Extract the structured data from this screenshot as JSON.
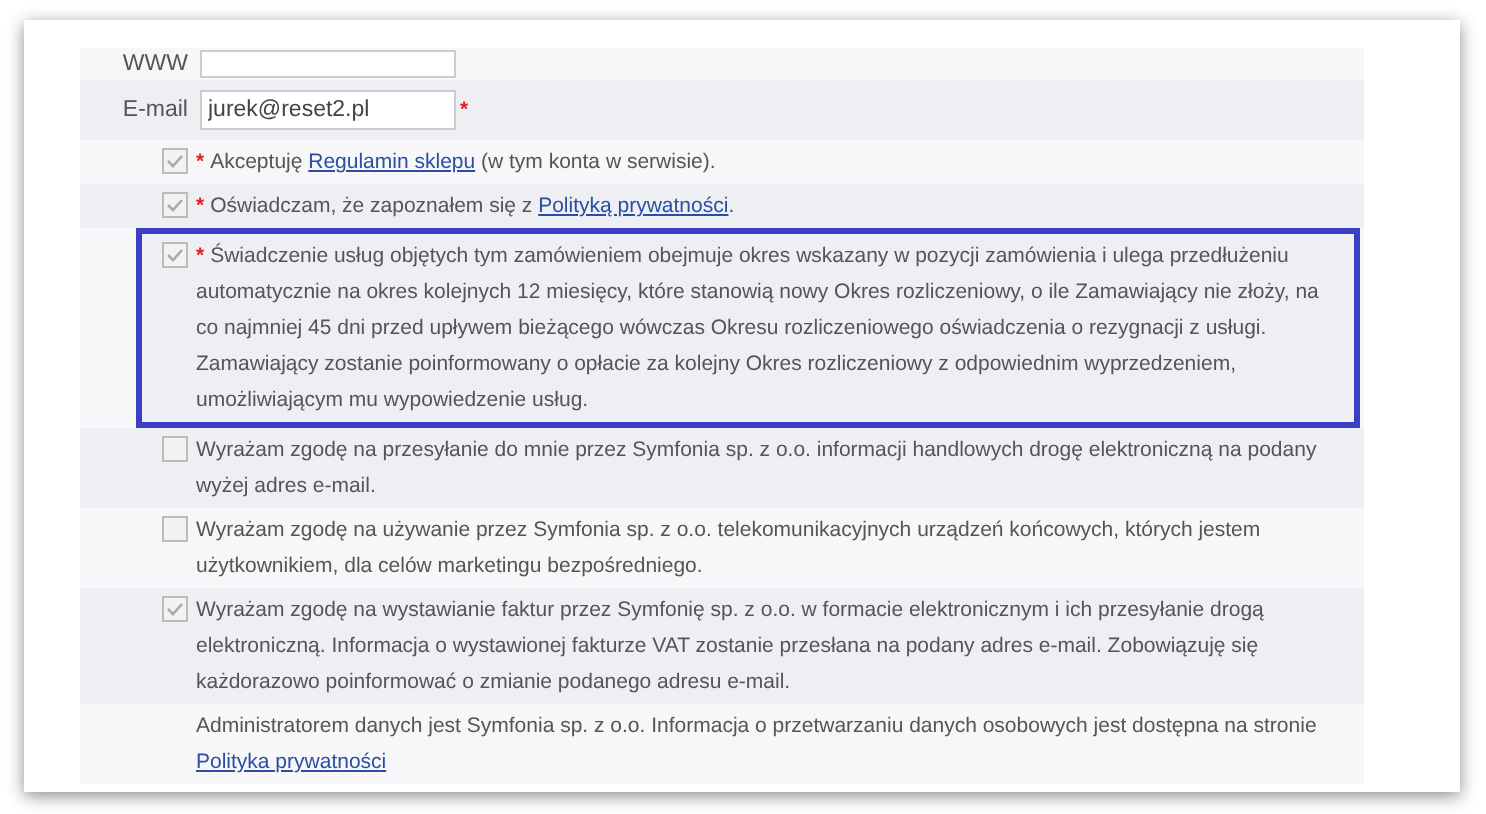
{
  "fields": [
    {
      "label": "WWW"
    },
    {
      "label": "E-mail",
      "value": "jurek@reset2.pl",
      "marker": "*"
    }
  ],
  "consents": [
    {
      "checked": true,
      "marker": "*",
      "highlighted": false,
      "parts": [
        {
          "kind": "text",
          "text": "Akceptuję "
        },
        {
          "kind": "link",
          "text": "Regulamin sklepu"
        },
        {
          "kind": "text",
          "text": " (w tym konta w serwisie)."
        }
      ]
    },
    {
      "checked": true,
      "marker": "*",
      "highlighted": false,
      "parts": [
        {
          "kind": "text",
          "text": "Oświadczam, że zapoznałem się z "
        },
        {
          "kind": "link",
          "text": "Polityką prywatności"
        },
        {
          "kind": "text",
          "text": "."
        }
      ]
    },
    {
      "checked": true,
      "marker": "*",
      "highlighted": true,
      "parts": [
        {
          "kind": "text",
          "text": "Świadczenie usług objętych tym zamówieniem obejmuje okres wskazany w pozycji zamówienia i ulega przedłużeniu automatycznie na okres kolejnych 12 miesięcy, które stanowią nowy Okres rozliczeniowy, o ile Zamawiający nie złoży, na co najmniej 45 dni przed upływem bieżącego wówczas Okresu rozliczeniowego oświadczenia o rezygnacji z usługi. Zamawiający zostanie poinformowany o opłacie za kolejny Okres rozliczeniowy z odpowiednim wyprzedzeniem, umożliwiającym mu wypowiedzenie usług."
        }
      ]
    },
    {
      "checked": false,
      "highlighted": false,
      "parts": [
        {
          "kind": "text",
          "text": "Wyrażam zgodę na przesyłanie do mnie przez Symfonia sp. z o.o. informacji handlowych drogę elektroniczną na podany wyżej adres e-mail."
        }
      ]
    },
    {
      "checked": false,
      "highlighted": false,
      "parts": [
        {
          "kind": "text",
          "text": "Wyrażam zgodę na używanie przez Symfonia sp. z o.o. telekomunikacyjnych urządzeń końcowych, których jestem użytkownikiem, dla celów marketingu bezpośredniego."
        }
      ]
    },
    {
      "checked": true,
      "highlighted": false,
      "parts": [
        {
          "kind": "text",
          "text": "Wyrażam zgodę na wystawianie faktur przez Symfonię sp. z o.o. w formacie elektronicznym i ich przesyłanie drogą elektroniczną. Informacja o wystawionej fakturze VAT zostanie przesłana na podany adres e-mail. Zobowiązuję się każdorazowo poinformować o zmianie podanego adresu e-mail."
        }
      ]
    }
  ],
  "notice": {
    "parts": [
      {
        "kind": "text",
        "text": "Administratorem danych jest Symfonia sp. z o.o. Informacja o przetwarzaniu danych osobowych jest dostępna na stronie "
      },
      {
        "kind": "link",
        "text": "Polityka prywatności"
      }
    ]
  }
}
